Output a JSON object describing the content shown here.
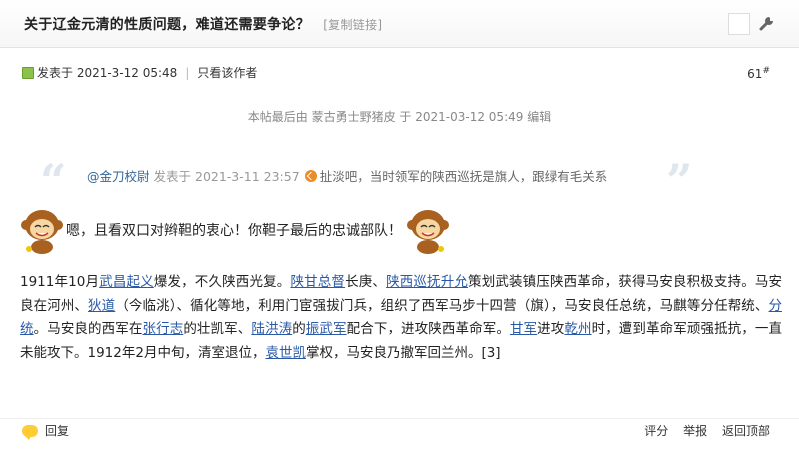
{
  "header": {
    "title": "关于辽金元清的性质问题，难道还需要争论？",
    "copy_link": "[复制链接]"
  },
  "post": {
    "posted_label": "发表于 2021-3-12 05:48",
    "only_author": "只看该作者",
    "floor": "61",
    "floor_mark": "#",
    "edited_note": "本帖最后由 蒙古勇士野猪皮 于 2021-03-12 05:49 编辑"
  },
  "quote": {
    "author": "@金刀校尉",
    "posted": "发表于 2021-3-11 23:57",
    "text": "扯淡吧，当时领军的陕西巡抚是旗人，跟绿有毛关系"
  },
  "reply_line": "嗯，且看双口对辫靼的衷心！你靼子最后的忠诚部队！",
  "body": {
    "p1": "1911年10月",
    "l1": "武昌起义",
    "p2": "爆发，不久陕西光复。",
    "l2": "陕甘总督",
    "p3": "长庚、",
    "l3": "陕西巡抚升允",
    "p4": "策划武装镇压陕西革命，获得马安良积极支持。马安良在河州、",
    "l4": "狄道",
    "p5": "（今临洮）、循化等地，利用门宦强拔门兵，组织了西军马步十四营（旗），马安良任总统，马麒等分任帮统、",
    "l5": "分统",
    "p6": "。马安良的西军在",
    "l6": "张行志",
    "p7": "的壮凯军、",
    "l7": "陆洪涛",
    "p8": "的",
    "l8": "振武军",
    "p9": "配合下，进攻陕西革命军。",
    "l9": "甘军",
    "p10": "进攻",
    "l10": "乾州",
    "p11": "时，遭到革命军顽强抵抗，一直未能攻下。1912年2月中旬，清室退位，",
    "l11": "袁世凯",
    "p12": "掌权，马安良乃撤军回兰州。[3]"
  },
  "footer": {
    "reply": "回复",
    "rate": "评分",
    "report": "举报",
    "top": "返回顶部"
  },
  "icons": [
    "online-icon",
    "wrench-icon",
    "back-arrow-icon",
    "monkey-emoji-icon",
    "reply-icon"
  ]
}
